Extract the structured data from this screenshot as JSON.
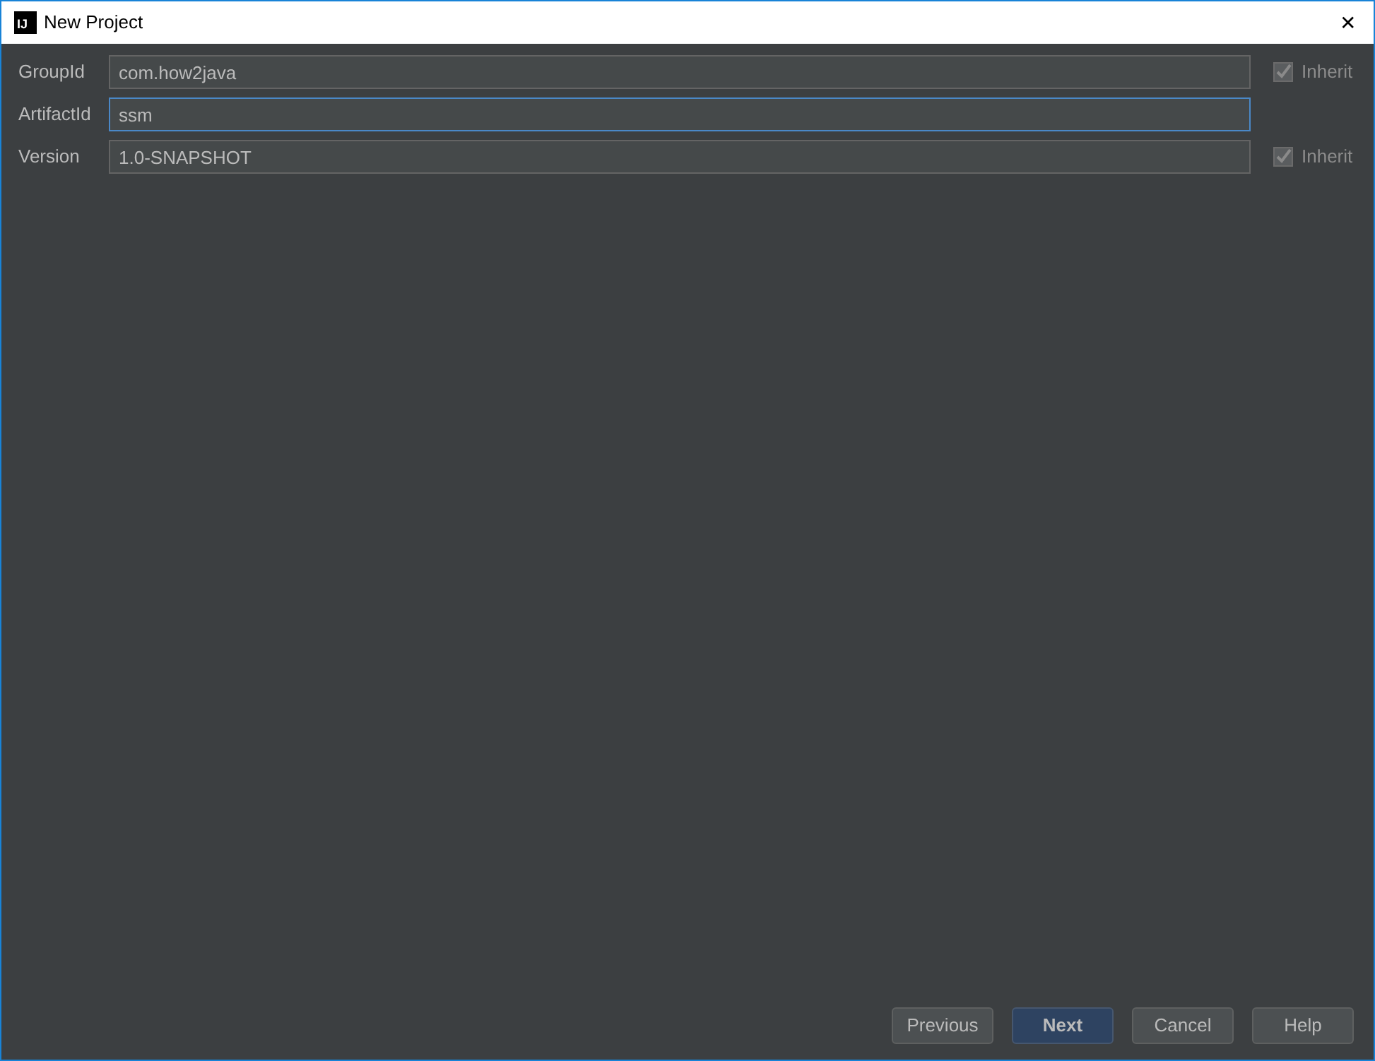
{
  "window": {
    "title": "New Project",
    "logo": "IJ",
    "close": "✕"
  },
  "fields": [
    {
      "label": "GroupId",
      "value": "com.how2java",
      "focused": false,
      "inherit": {
        "label": "Inherit",
        "checked": true
      }
    },
    {
      "label": "ArtifactId",
      "value": "ssm",
      "focused": true
    },
    {
      "label": "Version",
      "value": "1.0-SNAPSHOT",
      "focused": false,
      "inherit": {
        "label": "Inherit",
        "checked": true
      }
    }
  ],
  "buttons": [
    {
      "label": "Previous",
      "default": false
    },
    {
      "label": "Next",
      "default": true
    },
    {
      "label": "Cancel",
      "default": false
    },
    {
      "label": "Help",
      "default": false
    }
  ]
}
